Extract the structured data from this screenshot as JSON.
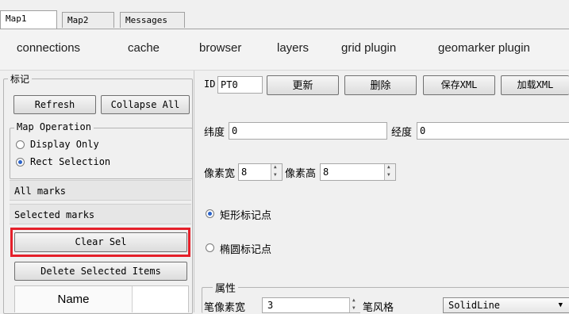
{
  "window_tabs": [
    "Map1",
    "Map2",
    "Messages"
  ],
  "toolbar_tabs": [
    "connections",
    "cache",
    "browser",
    "layers",
    "grid plugin",
    "geomarker plugin"
  ],
  "left": {
    "group_title": "标记",
    "refresh": "Refresh",
    "collapse_all": "Collapse All",
    "map_operation_title": "Map Operation",
    "display_only": "Display Only",
    "rect_selection": "Rect Selection",
    "all_marks": "All marks",
    "selected_marks": "Selected marks",
    "clear_sel": "Clear Sel",
    "delete_selected": "Delete Selected Items",
    "name_header": "Name"
  },
  "right": {
    "id_label": "ID",
    "id_value": "PT0",
    "update": "更新",
    "delete": "删除",
    "save_xml": "保存XML",
    "load_xml": "加载XML",
    "lat_label": "纬度",
    "lat_value": "0",
    "lon_label": "经度",
    "lon_value": "0",
    "px_width_label": "像素宽",
    "px_width_value": "8",
    "px_height_label": "像素高",
    "px_height_value": "8",
    "rect_marker": "矩形标记点",
    "ellipse_marker": "椭圆标记点",
    "attr_title": "属性",
    "pen_width_label": "笔像素宽",
    "pen_width_value": "3",
    "pen_style_label": "笔风格",
    "pen_style_value": "SolidLine"
  },
  "colors": {
    "highlight": "#e5202a",
    "radio_dot": "#2b63c9"
  }
}
